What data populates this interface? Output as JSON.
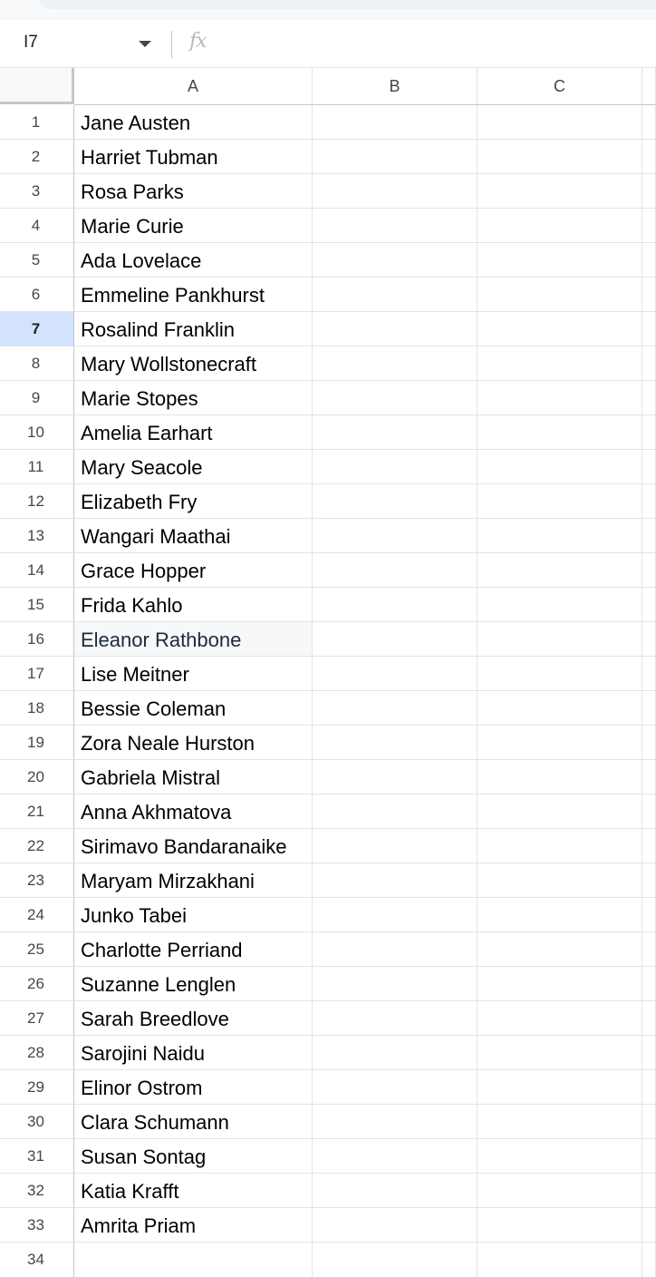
{
  "namebox": {
    "value": "I7"
  },
  "formula_bar": {
    "fx_label": "fx",
    "value": ""
  },
  "columns": [
    "A",
    "B",
    "C"
  ],
  "active_row": "7",
  "rows": [
    {
      "num": "1",
      "a": "Jane Austen"
    },
    {
      "num": "2",
      "a": "Harriet Tubman"
    },
    {
      "num": "3",
      "a": "Rosa Parks"
    },
    {
      "num": "4",
      "a": "Marie Curie"
    },
    {
      "num": "5",
      "a": "Ada Lovelace"
    },
    {
      "num": "6",
      "a": "Emmeline Pankhurst"
    },
    {
      "num": "7",
      "a": "Rosalind Franklin"
    },
    {
      "num": "8",
      "a": "Mary Wollstonecraft"
    },
    {
      "num": "9",
      "a": "Marie Stopes"
    },
    {
      "num": "10",
      "a": "Amelia Earhart"
    },
    {
      "num": "11",
      "a": "Mary Seacole"
    },
    {
      "num": "12",
      "a": "Elizabeth Fry"
    },
    {
      "num": "13",
      "a": "Wangari Maathai"
    },
    {
      "num": "14",
      "a": "Grace Hopper"
    },
    {
      "num": "15",
      "a": "Frida Kahlo"
    },
    {
      "num": "16",
      "a": "Eleanor Rathbone"
    },
    {
      "num": "17",
      "a": "Lise Meitner"
    },
    {
      "num": "18",
      "a": "Bessie Coleman"
    },
    {
      "num": "19",
      "a": "Zora Neale Hurston"
    },
    {
      "num": "20",
      "a": "Gabriela Mistral"
    },
    {
      "num": "21",
      "a": "Anna Akhmatova"
    },
    {
      "num": "22",
      "a": "Sirimavo Bandaranaike"
    },
    {
      "num": "23",
      "a": "Maryam Mirzakhani"
    },
    {
      "num": "24",
      "a": "Junko Tabei"
    },
    {
      "num": "25",
      "a": "Charlotte Perriand"
    },
    {
      "num": "26",
      "a": "Suzanne Lenglen"
    },
    {
      "num": "27",
      "a": "Sarah Breedlove"
    },
    {
      "num": "28",
      "a": "Sarojini Naidu"
    },
    {
      "num": "29",
      "a": "Elinor Ostrom"
    },
    {
      "num": "30",
      "a": "Clara Schumann"
    },
    {
      "num": "31",
      "a": "Susan Sontag"
    },
    {
      "num": "32",
      "a": "Katia Krafft"
    },
    {
      "num": "33",
      "a": "Amrita Priam"
    },
    {
      "num": "34",
      "a": ""
    }
  ],
  "hovered_cell_row": "16"
}
